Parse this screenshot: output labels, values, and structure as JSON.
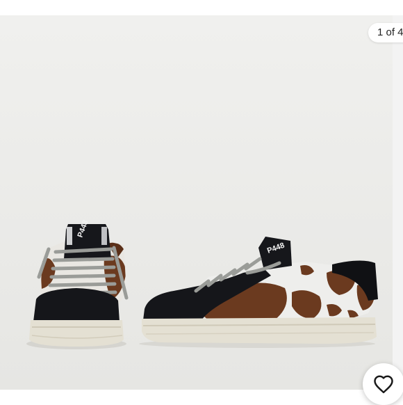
{
  "gallery": {
    "counter_text": "1 of 4",
    "like_icon": "heart-icon",
    "image_subject": "shoes"
  },
  "shoe_left": {
    "heel_text": "P448"
  },
  "shoe_right": {
    "tongue_text": "P448"
  },
  "colors": {
    "background": "#ebebea",
    "suede": "#15161a",
    "cow_brown": "#6b3a1f",
    "cow_white": "#eeeeec",
    "sole": "#e4e0d3",
    "laces": "#9a9c98"
  }
}
